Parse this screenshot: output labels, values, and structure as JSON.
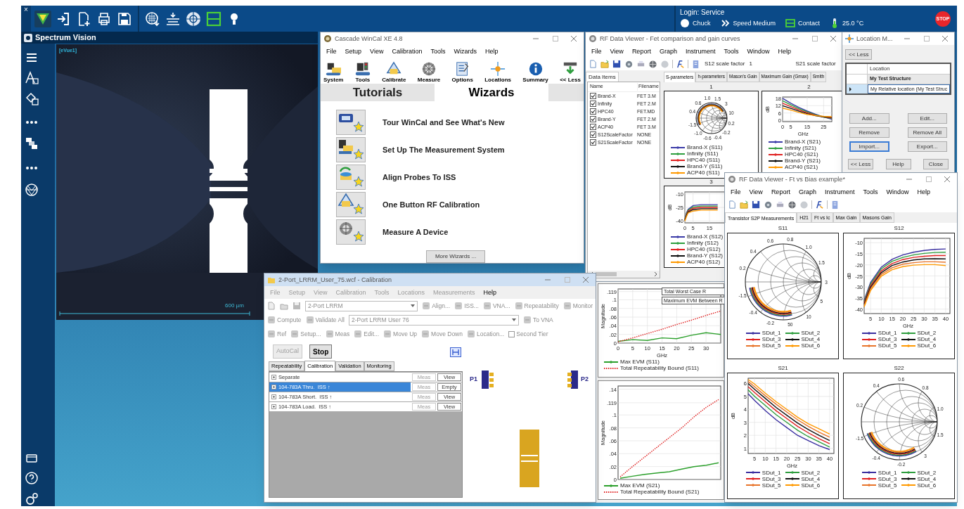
{
  "top_bar": {
    "close_glyph": "×",
    "login": "Login: Service",
    "status": [
      {
        "kind": "chuck",
        "label": "Chuck"
      },
      {
        "kind": "speed",
        "label": "Speed Medium"
      },
      {
        "kind": "contact",
        "label": "Contact"
      },
      {
        "kind": "temperature",
        "label": "25.0 °C"
      }
    ],
    "stop": "STOP"
  },
  "spectrum_vision": {
    "title": "Spectrum Vision",
    "view_label": "[eVue1]",
    "scale_label": "600 µm"
  },
  "wincal": {
    "title": "Cascade WinCal XE 4.8",
    "menu": [
      "File",
      "Setup",
      "View",
      "Calibration",
      "Tools",
      "Wizards",
      "Help"
    ],
    "toolbar": [
      "System",
      "Tools",
      "Calibrate",
      "Measure",
      "Options",
      "Locations",
      "Summary",
      "<< Less"
    ],
    "tabs": [
      {
        "label": "Tutorials",
        "selected": false
      },
      {
        "label": "Wizards",
        "selected": true
      }
    ],
    "wizards": [
      "Tour WinCal and See What's New",
      "Set Up The Measurement System",
      "Align Probes To ISS",
      "One Button RF Calibration",
      "Measure A Device"
    ],
    "more_button": "More Wizards ..."
  },
  "rf_viewer_1": {
    "title": "RF Data Viewer - Fet comparison and gain curves",
    "menu": [
      "File",
      "View",
      "Report",
      "Graph",
      "Instrument",
      "Tools",
      "Window",
      "Help"
    ],
    "s12_label": "S12 scale factor",
    "s12_value": "1",
    "s21_label": "S21 scale factor",
    "panel_tab": "Data Items",
    "columns": [
      "Name",
      "Filename"
    ],
    "items": [
      {
        "name": "Brand-X",
        "file": "FET 3.M",
        "checked": true
      },
      {
        "name": "Infinity",
        "file": "FET 2.M",
        "checked": true
      },
      {
        "name": "HPC40",
        "file": "FET.MD",
        "checked": true
      },
      {
        "name": "Brand-Y",
        "file": "FET 2.M",
        "checked": true
      },
      {
        "name": "ACP40",
        "file": "FET 3.M",
        "checked": true
      },
      {
        "name": "S12ScaleFactor",
        "file": "NONE",
        "checked": true
      },
      {
        "name": "S21ScaleFactor",
        "file": "NONE",
        "checked": true
      }
    ],
    "tabs": [
      {
        "label": "S-parameters",
        "selected": true
      },
      {
        "label": "h-parameters",
        "selected": false
      },
      {
        "label": "Mason's Gain",
        "selected": false
      },
      {
        "label": "Maximum Gain (Gmax)",
        "selected": false
      },
      {
        "label": "Smith",
        "selected": false
      }
    ],
    "charts": [
      {
        "title": "1",
        "kind": "smith",
        "labels": [
          "0.4",
          "0.6",
          "1.0",
          "1.5",
          "3",
          "10",
          "0.2",
          "-0.2",
          "-0.4",
          "-0.6",
          "-1.0",
          "-1.5"
        ],
        "legend": [
          {
            "label": "Brand-X (S11)",
            "color": "#3b3ba8"
          },
          {
            "label": "Infinity (S11)",
            "color": "#2e9e3e"
          },
          {
            "label": "HPC40 (S11)",
            "color": "#e02020"
          },
          {
            "label": "Brand-Y (S11)",
            "color": "#111111"
          },
          {
            "label": "ACP40 (S11)",
            "color": "#ff9900"
          }
        ]
      },
      {
        "chart_data": {
          "type": "line",
          "title": "2",
          "ylabel": "dB",
          "xlabel": "GHz",
          "grid": true,
          "x": [
            0,
            5,
            10,
            15,
            20,
            25,
            30
          ],
          "xlim": [
            0,
            30
          ],
          "ylim": [
            -1,
            19
          ],
          "xticks": [
            0,
            5,
            15,
            25
          ],
          "yticks": [
            0,
            6,
            12,
            18
          ],
          "series": [
            {
              "name": "Brand-X (S21)",
              "color": "#3b3ba8",
              "values": [
                18,
                14.0,
                10.5,
                7.6,
                5.0,
                2.8,
                1.0
              ]
            },
            {
              "name": "Infinity (S21)",
              "color": "#2e9e3e",
              "values": [
                16,
                12.6,
                9.5,
                6.9,
                4.6,
                2.7,
                1.5
              ]
            },
            {
              "name": "HPC40 (S21)",
              "color": "#e02020",
              "values": [
                14,
                11.2,
                8.5,
                6.2,
                4.2,
                2.8,
                2.0
              ]
            },
            {
              "name": "Brand-Y (S21)",
              "color": "#111111",
              "values": [
                12,
                9.8,
                7.5,
                5.5,
                3.8,
                2.9,
                2.5
              ]
            },
            {
              "name": "ACP40 (S21)",
              "color": "#ff9900",
              "values": [
                10,
                8.4,
                6.5,
                4.8,
                3.9,
                3.3,
                3.0
              ]
            }
          ]
        }
      },
      {
        "chart_data": {
          "type": "line",
          "title": "3",
          "ylabel": "dB",
          "grid": true,
          "x": [
            0,
            1,
            2,
            5,
            10,
            15,
            20
          ],
          "xlim": [
            0,
            30
          ],
          "ylim": [
            -42,
            -8
          ],
          "xticks": [
            0,
            5,
            15
          ],
          "yticks": [
            -40,
            -25,
            -10
          ],
          "series": [
            {
              "name": "Brand-X (S12)",
              "color": "#3b3ba8",
              "values": [
                -38,
                -31,
                -27,
                -23,
                -22,
                -22,
                -22
              ]
            },
            {
              "name": "Infinity (S12)",
              "color": "#2e9e3e",
              "values": [
                -38.5,
                -32,
                -28,
                -24.5,
                -23.5,
                -23.5,
                -23.5
              ]
            },
            {
              "name": "HPC40 (S12)",
              "color": "#e02020",
              "values": [
                -39,
                -33,
                -29,
                -26,
                -25,
                -25,
                -25
              ]
            },
            {
              "name": "Brand-Y (S12)",
              "color": "#111111",
              "values": [
                -39.5,
                -34,
                -30,
                -27.5,
                -26.5,
                -26.5,
                -26.5
              ]
            },
            {
              "name": "ACP40 (S12)",
              "color": "#ff9900",
              "values": [
                -40,
                -35,
                -31,
                -29,
                -28,
                -28,
                -28
              ]
            }
          ]
        }
      }
    ]
  },
  "location_manager": {
    "title": "Location M...",
    "top_button": "<< Less",
    "column": "Location",
    "rows": [
      {
        "text": "My Test Structure",
        "kind": "structure",
        "selected": false
      },
      {
        "text": "My Relative location (My Test Struc",
        "kind": "location",
        "selected": true
      }
    ],
    "buttons": [
      {
        "label": "Add...",
        "focused": false
      },
      {
        "label": "Edit...",
        "focused": false
      },
      {
        "label": "Remove",
        "focused": false
      },
      {
        "label": "Remove All",
        "focused": false
      },
      {
        "label": "Import...",
        "focused": true
      },
      {
        "label": "Export...",
        "focused": false
      }
    ],
    "footer_buttons": [
      "<< Less",
      "Help",
      "Close"
    ]
  },
  "evm_window": {
    "charts": [
      {
        "annotations": [
          "Total Worst Case R",
          "Maximum EVM Between R"
        ],
        "chart_data": {
          "type": "line",
          "ylabel": "Magnitude",
          "xlabel": "GHz",
          "grid": true,
          "x": [
            0,
            5,
            10,
            15,
            20,
            25,
            30,
            35
          ],
          "xlim": [
            0,
            35
          ],
          "ylim": [
            0,
            0.125
          ],
          "xticks": [
            0,
            5,
            10,
            15,
            20,
            25,
            30
          ],
          "yticks": [
            0,
            {
              "value": 0.02,
              "label": ".02"
            },
            {
              "value": 0.04,
              "label": ".04"
            },
            {
              "value": 0.06,
              "label": ".06"
            },
            {
              "value": 0.08,
              "label": ".08"
            },
            {
              "value": 0.1,
              "label": ".1"
            },
            {
              "value": 0.119,
              "label": ".119"
            }
          ],
          "series": [
            {
              "name": "Max EVM (S11)",
              "color": "#2ca02c",
              "values": [
                0.004,
                0.008,
                0.006,
                0.012,
                0.01,
                0.018,
                0.024,
                0.02
              ]
            },
            {
              "name": "Total Repeatability Bound (S11)",
              "color": "#e02020",
              "line_style": "dotted",
              "values": [
                0.003,
                0.012,
                0.022,
                0.032,
                0.043,
                0.053,
                0.064,
                0.074
              ]
            }
          ]
        }
      },
      {
        "chart_data": {
          "type": "line",
          "ylabel": "Magnitude",
          "grid": true,
          "categories": [
            null,
            null,
            null,
            null,
            null,
            null,
            null,
            null,
            null
          ],
          "ylim": [
            0,
            0.145
          ],
          "yticks": [
            0,
            {
              "value": 0.02,
              "label": ".02"
            },
            {
              "value": 0.04,
              "label": ".04"
            },
            {
              "value": 0.06,
              "label": ".06"
            },
            {
              "value": 0.08,
              "label": ".08"
            },
            {
              "value": 0.1,
              "label": ".1"
            },
            {
              "value": 0.119,
              "label": ".119"
            },
            {
              "value": 0.14,
              "label": ".14"
            }
          ],
          "series": [
            {
              "name": "Max EVM (S21)",
              "color": "#2ca02c",
              "values": [
                0.002,
                0.005,
                0.008,
                0.01,
                0.012,
                0.016,
                0.02,
                0.022,
                0.026
              ]
            },
            {
              "name": "Total Repeatability Bound (S21)",
              "color": "#e02020",
              "line_style": "dotted",
              "values": [
                0.004,
                0.02,
                0.035,
                0.05,
                0.065,
                0.08,
                0.097,
                0.112,
                0.124
              ]
            }
          ]
        }
      }
    ]
  },
  "calibration": {
    "title": "2-Port_LRRM_User_75.wcf - Calibration",
    "menu": [
      {
        "label": "File",
        "disabled": true
      },
      {
        "label": "Setup",
        "disabled": true
      },
      {
        "label": "View",
        "disabled": true
      },
      {
        "label": "Calibration",
        "disabled": true
      },
      {
        "label": "Tools",
        "disabled": true
      },
      {
        "label": "Locations",
        "disabled": true
      },
      {
        "label": "Measurements",
        "disabled": true
      },
      {
        "label": "Help",
        "disabled": false
      }
    ],
    "method": "2-Port LRRM",
    "row1_buttons": [
      "Align...",
      "ISS...",
      "VNA...",
      "Repeatability",
      "Monitor"
    ],
    "row2_buttons": [
      "Compute",
      "Validate All"
    ],
    "cal_name": "2-Port LRRM User 76",
    "to_vna": "To VNA",
    "row3_buttons": [
      "Ref",
      "Setup...",
      "Meas",
      "Edit...",
      "Move Up",
      "Move Down",
      "Location..."
    ],
    "second_tier": {
      "label": "Second Tier",
      "checked": false
    },
    "autocal": {
      "label": "AutoCal",
      "disabled": true
    },
    "stop": {
      "label": "Stop",
      "disabled": false
    },
    "tabs": [
      {
        "label": "Repeatability",
        "selected": false
      },
      {
        "label": "Calibration",
        "selected": true
      },
      {
        "label": "Validation",
        "selected": false
      },
      {
        "label": "Monitoring",
        "selected": false
      }
    ],
    "standards": [
      {
        "label": "Separate",
        "selected": false,
        "meas": "Meas",
        "view": "View"
      },
      {
        "label": "104-783A Thru.  ISS ↑",
        "selected": true,
        "meas": "Meas",
        "view": "Empty"
      },
      {
        "label": "104-783A Short.  ISS ↑",
        "selected": false,
        "meas": "Meas",
        "view": "View"
      },
      {
        "label": "104-783A Load.  ISS ↑",
        "selected": false,
        "meas": "Meas",
        "view": "View"
      }
    ],
    "probe_labels": [
      "P1",
      "P2"
    ]
  },
  "rf_viewer_2": {
    "title": "RF Data Viewer - Ft vs Bias example*",
    "menu": [
      "File",
      "View",
      "Report",
      "Graph",
      "Instrument",
      "Tools",
      "Window",
      "Help"
    ],
    "tabs": [
      {
        "label": "Transistor S2P Measurements",
        "selected": true
      },
      {
        "label": "H21",
        "selected": false
      },
      {
        "label": "Ft vs Ic",
        "selected": false
      },
      {
        "label": "Max Gain",
        "selected": false
      },
      {
        "label": "Masons Gain",
        "selected": false
      }
    ],
    "charts": [
      {
        "title": "S11",
        "kind": "smith",
        "labels": [
          "0.2",
          "0.4",
          "0.6",
          "0.8",
          "1.0",
          "1.5",
          "3",
          "5",
          "10",
          "50",
          "-0.2",
          "-0.4",
          "-1.5"
        ],
        "legend": [
          {
            "label": "SDut_1",
            "color": "#3a2fa0"
          },
          {
            "label": "SDut_2",
            "color": "#2e9e3e"
          },
          {
            "label": "SDut_3",
            "color": "#e02020"
          },
          {
            "label": "SDut_4",
            "color": "#111111"
          },
          {
            "label": "SDut_5",
            "color": "#e8742a"
          },
          {
            "label": "SDut_6",
            "color": "#ff9900"
          }
        ]
      },
      {
        "chart_data": {
          "type": "line",
          "title": "S12",
          "ylabel": "dB",
          "xlabel": "GHz",
          "grid": true,
          "x": [
            2,
            5,
            10,
            15,
            20,
            25,
            30,
            35,
            40
          ],
          "xlim": [
            2,
            42
          ],
          "ylim": [
            -42,
            -8
          ],
          "xticks": [
            5,
            10,
            15,
            20,
            25,
            30,
            35,
            40
          ],
          "yticks": [
            -40,
            -35,
            -30,
            -25,
            -20,
            -15,
            -10
          ],
          "series": [
            {
              "name": "SDut_1",
              "color": "#3a2fa0",
              "values": [
                -36,
                -28,
                -21,
                -17.5,
                -15.5,
                -14.3,
                -13.5,
                -13,
                -12.8
              ]
            },
            {
              "name": "SDut_2",
              "color": "#2e9e3e",
              "values": [
                -36.6,
                -28.7,
                -21.8,
                -18.4,
                -16.6,
                -15.5,
                -14.8,
                -14.4,
                -14.3
              ]
            },
            {
              "name": "SDut_3",
              "color": "#e02020",
              "values": [
                -37.2,
                -29.4,
                -22.7,
                -19.4,
                -17.6,
                -16.6,
                -16.1,
                -15.8,
                -15.8
              ]
            },
            {
              "name": "SDut_4",
              "color": "#111111",
              "values": [
                -37.8,
                -30.1,
                -23.5,
                -20.3,
                -18.7,
                -17.8,
                -17.3,
                -17.2,
                -17.3
              ]
            },
            {
              "name": "SDut_5",
              "color": "#e8742a",
              "values": [
                -38.4,
                -30.9,
                -24.3,
                -21.3,
                -19.7,
                -19.0,
                -18.6,
                -18.6,
                -18.8
              ]
            },
            {
              "name": "SDut_6",
              "color": "#ff9900",
              "values": [
                -39,
                -31.6,
                -25.1,
                -22.2,
                -20.8,
                -20.1,
                -19.9,
                -19.9,
                -20.3
              ]
            }
          ]
        }
      },
      {
        "chart_data": {
          "type": "line",
          "title": "S21",
          "ylabel": "dB",
          "xlabel": "GHz",
          "grid": true,
          "x": [
            2,
            5,
            10,
            15,
            20,
            25,
            30,
            35,
            40
          ],
          "xlim": [
            2,
            42
          ],
          "ylim": [
            0.6,
            6.4
          ],
          "xticks": [
            5,
            10,
            15,
            20,
            25,
            30,
            35,
            40
          ],
          "yticks": [
            1,
            2,
            3,
            4,
            5,
            6
          ],
          "series": [
            {
              "name": "SDut_1",
              "color": "#3a2fa0",
              "values": [
                5.2,
                4.7,
                3.9,
                3.2,
                2.6,
                2.0,
                1.6,
                1.2,
                0.9
              ]
            },
            {
              "name": "SDut_2",
              "color": "#2e9e3e",
              "values": [
                5.5,
                5.0,
                4.3,
                3.6,
                3.0,
                2.4,
                1.9,
                1.5,
                1.1
              ]
            },
            {
              "name": "SDut_3",
              "color": "#e02020",
              "values": [
                5.75,
                5.3,
                4.6,
                3.9,
                3.3,
                2.7,
                2.2,
                1.75,
                1.35
              ]
            },
            {
              "name": "SDut_4",
              "color": "#111111",
              "values": [
                6.0,
                5.55,
                4.85,
                4.15,
                3.55,
                2.95,
                2.45,
                2.0,
                1.6
              ]
            },
            {
              "name": "SDut_5",
              "color": "#e8742a",
              "values": [
                6.15,
                5.75,
                5.05,
                4.4,
                3.8,
                3.2,
                2.7,
                2.25,
                1.85
              ]
            },
            {
              "name": "SDut_6",
              "color": "#ff9900",
              "values": [
                6.3,
                5.95,
                5.25,
                4.6,
                4.0,
                3.4,
                2.9,
                2.5,
                2.1
              ]
            }
          ]
        }
      },
      {
        "title": "S22",
        "kind": "smith",
        "labels": [
          "0.2",
          "0.4",
          "0.6",
          "0.8",
          "1.0",
          "1.5",
          "3",
          "-0.2",
          "-0.4",
          "-1.5"
        ],
        "legend": [
          {
            "label": "SDut_1",
            "color": "#3a2fa0"
          },
          {
            "label": "SDut_2",
            "color": "#2e9e3e"
          },
          {
            "label": "SDut_3",
            "color": "#e02020"
          },
          {
            "label": "SDut_4",
            "color": "#111111"
          },
          {
            "label": "SDut_5",
            "color": "#e8742a"
          },
          {
            "label": "SDut_6",
            "color": "#ff9900"
          }
        ]
      }
    ]
  }
}
